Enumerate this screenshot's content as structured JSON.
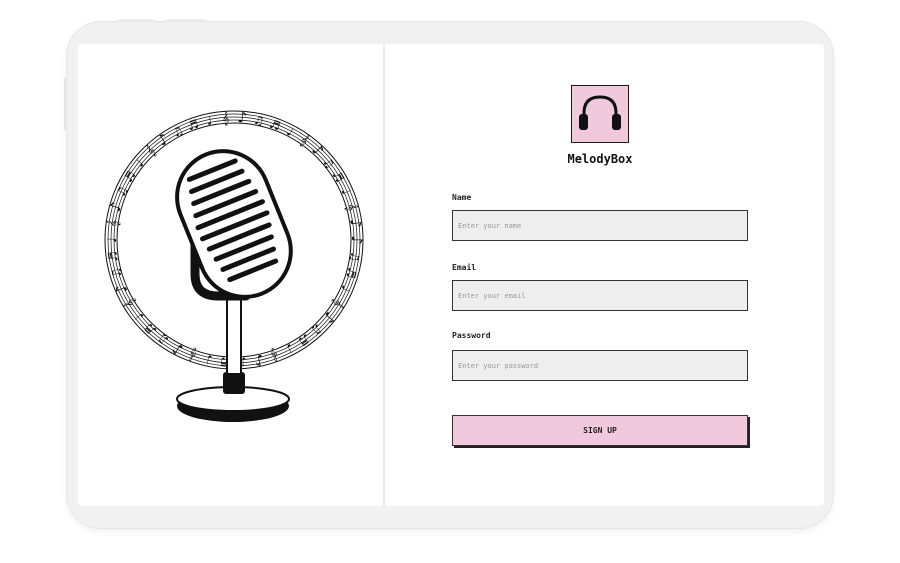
{
  "brand": {
    "name": "MelodyBox",
    "logo_icon": "headphones-icon",
    "logo_bg": "#f0c9dc"
  },
  "illustration": {
    "icon": "microphone-icon",
    "ring_icon": "music-notes-ring-icon"
  },
  "form": {
    "fields": [
      {
        "label": "Name",
        "placeholder": "Enter your name",
        "value": ""
      },
      {
        "label": "Email",
        "placeholder": "Enter your email",
        "value": ""
      },
      {
        "label": "Password",
        "placeholder": "Enter your password",
        "value": ""
      }
    ],
    "submit_label": "SIGN UP",
    "accent": "#f0c9dc"
  }
}
